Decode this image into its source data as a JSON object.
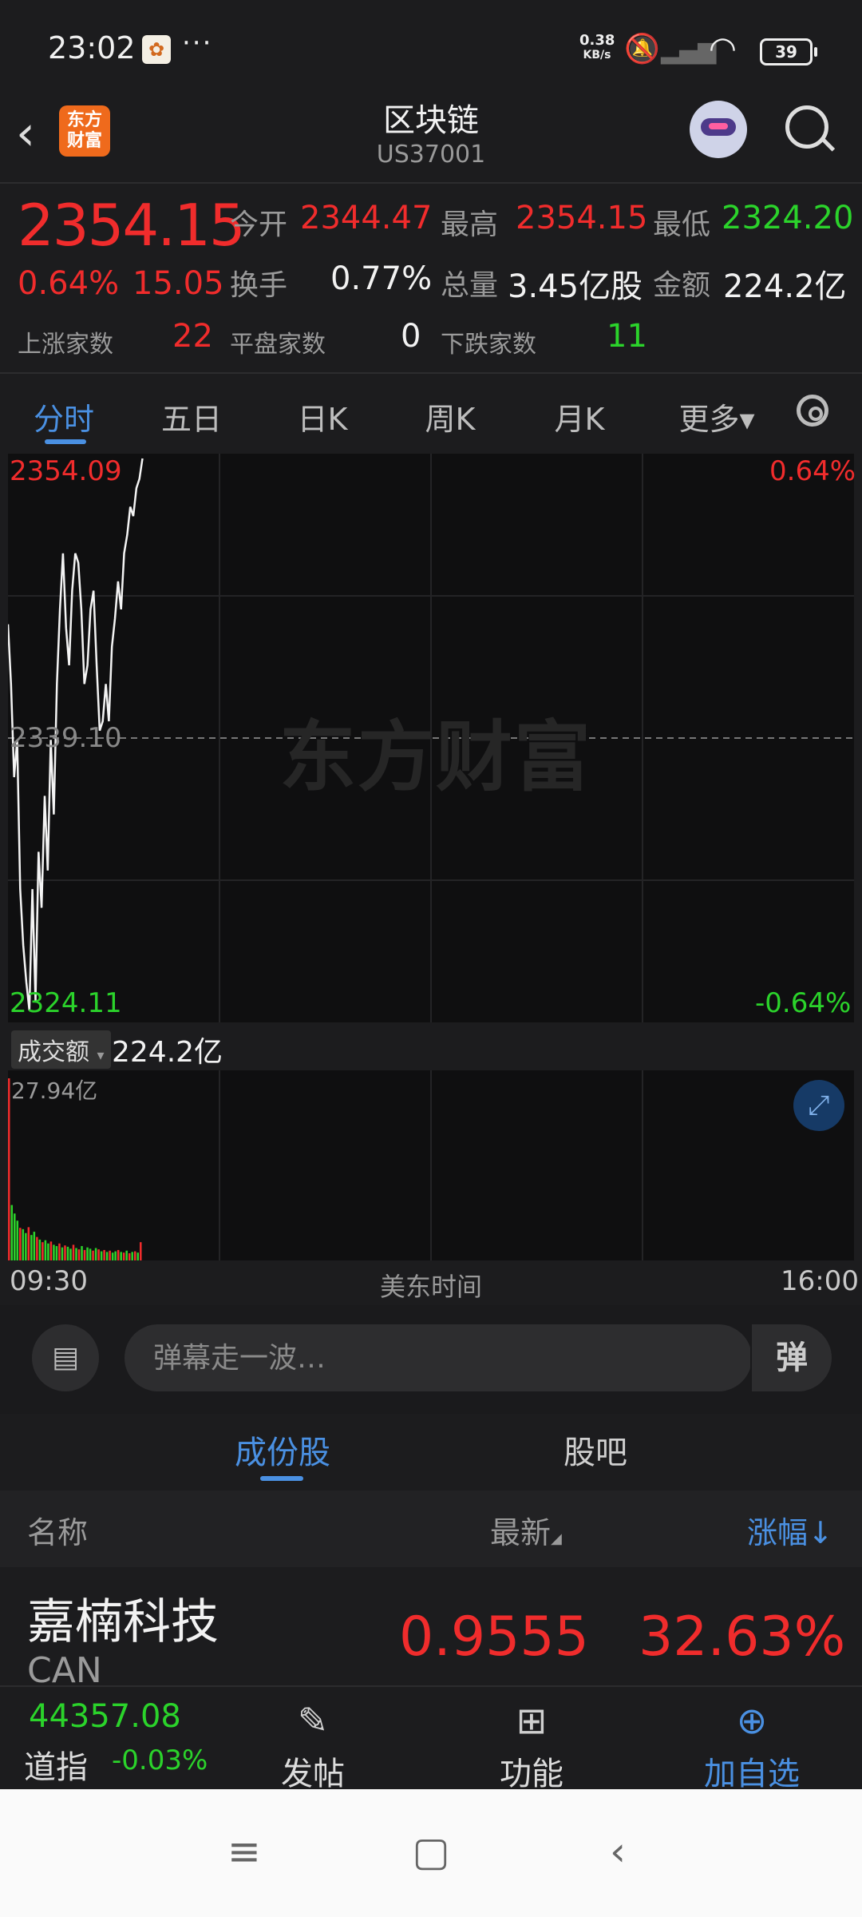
{
  "status_bar": {
    "time": "23:02",
    "more": "···",
    "net_speed_value": "0.38",
    "net_speed_unit": "KB/s",
    "battery": "39"
  },
  "header": {
    "logo_text": "东方财富",
    "title": "区块链",
    "code": "US37001"
  },
  "quote": {
    "price": "2354.15",
    "change_pct": "0.64%",
    "change_val": "15.05",
    "open_label": "今开",
    "open": "2344.47",
    "high_label": "最高",
    "high": "2354.15",
    "low_label": "最低",
    "low": "2324.20",
    "turnover_label": "换手",
    "turnover": "0.77%",
    "volume_label": "总量",
    "volume": "3.45亿股",
    "amount_label": "金额",
    "amount": "224.2亿",
    "up_label": "上涨家数",
    "up": "22",
    "flat_label": "平盘家数",
    "flat": "0",
    "down_label": "下跌家数",
    "down": "11"
  },
  "tabs": [
    {
      "label": "分时"
    },
    {
      "label": "五日"
    },
    {
      "label": "日K"
    },
    {
      "label": "周K"
    },
    {
      "label": "月K"
    },
    {
      "label": "更多▾"
    }
  ],
  "chart_data": {
    "type": "line",
    "y_max_label": "2354.09",
    "y_mid_label": "2339.10",
    "y_min_label": "2324.11",
    "pct_max_label": "0.64%",
    "pct_min_label": "-0.64%",
    "watermark": "东方财富",
    "ylim": [
      2324.11,
      2354.09
    ],
    "reference": 2339.1,
    "x_start": "09:30",
    "x_end": "16:00",
    "x_label": "美东时间",
    "total_minutes": 390,
    "price": [
      2345.2,
      2342.0,
      2337.0,
      2339.0,
      2331.0,
      2328.0,
      2326.0,
      2324.5,
      2331.0,
      2325.0,
      2333.0,
      2330.0,
      2336.0,
      2332.0,
      2339.0,
      2335.0,
      2342.0,
      2346.0,
      2349.0,
      2345.0,
      2343.0,
      2347.0,
      2349.0,
      2348.5,
      2346.0,
      2342.0,
      2343.0,
      2346.0,
      2347.0,
      2343.0,
      2339.5,
      2340.0,
      2342.0,
      2340.0,
      2344.0,
      2345.5,
      2347.5,
      2346.0,
      2349.0,
      2350.0,
      2351.5,
      2351.0,
      2352.5,
      2353.0,
      2354.09
    ],
    "volume_label": "成交额",
    "volume_total": "224.2亿",
    "volume_max_label": "27.94亿",
    "volume_max": 27.94,
    "volume": [
      27.94,
      8.5,
      7.2,
      6.1,
      5.0,
      4.8,
      4.2,
      5.1,
      3.9,
      4.4,
      3.6,
      3.2,
      2.8,
      3.1,
      2.6,
      2.9,
      2.4,
      2.2,
      2.6,
      2.0,
      2.3,
      2.1,
      1.8,
      2.4,
      1.9,
      1.7,
      2.2,
      1.6,
      2.0,
      1.8,
      1.5,
      1.9,
      1.7,
      1.4,
      1.6,
      1.3,
      1.5,
      1.2,
      1.4,
      1.6,
      1.3,
      1.2,
      1.5,
      1.1,
      1.3,
      1.4,
      1.2,
      2.8
    ],
    "volume_colors": [
      "red",
      "green",
      "green",
      "green",
      "red",
      "green",
      "green",
      "red",
      "green",
      "green",
      "red",
      "green",
      "red",
      "green",
      "green",
      "red",
      "green",
      "green",
      "red",
      "green",
      "red",
      "green",
      "green",
      "red",
      "green",
      "red",
      "green",
      "red",
      "green",
      "green",
      "red",
      "green",
      "red",
      "green",
      "red",
      "green",
      "red",
      "green",
      "green",
      "red",
      "green",
      "red",
      "green",
      "red",
      "green",
      "red",
      "green",
      "red"
    ]
  },
  "danmu": {
    "placeholder": "弹幕走一波…",
    "send": "弹"
  },
  "sub_tabs": [
    {
      "label": "成份股"
    },
    {
      "label": "股吧"
    }
  ],
  "list_header": {
    "name": "名称",
    "latest": "最新",
    "change": "涨幅↓"
  },
  "stocks": [
    {
      "name": "嘉楠科技",
      "code": "CAN",
      "price": "0.9555",
      "change": "32.63%"
    }
  ],
  "toolbar": {
    "index_value": "44357.08",
    "index_name": "道指",
    "index_change": "-0.03%",
    "post": "发帖",
    "functions": "功能",
    "add_watch": "加自选"
  },
  "colors": {
    "up": "#f02c2c",
    "down": "#2bd32b",
    "accent": "#4a90e2",
    "background": "#1c1c1e"
  }
}
